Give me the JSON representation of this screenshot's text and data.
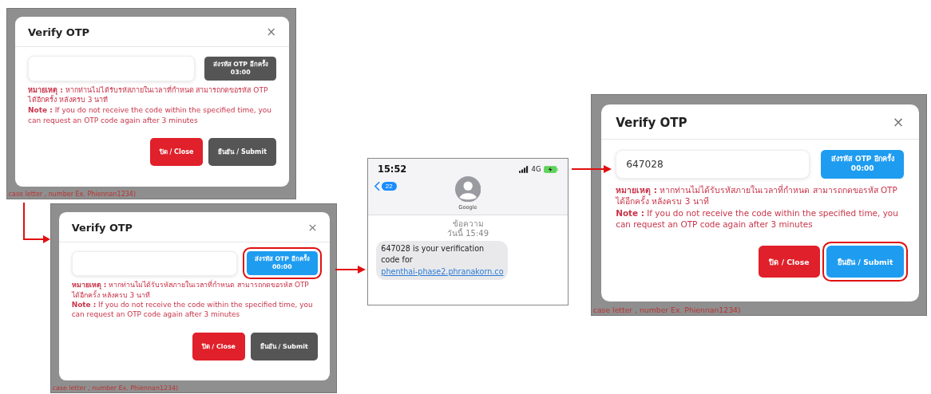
{
  "panels": [
    {
      "kind": "dialog",
      "title": "Verify OTP",
      "close_icon": "×",
      "resend": {
        "label": "ส่งรหัส OTP อีกครั้ง",
        "timer": "03:00",
        "enabled": false,
        "highlighted": false
      },
      "note_th": "**หมายเหตุ :** หากท่านไม่ได้รับรหัสภายในเวลาที่กำหนด สามารถกดขอรหัส OTP ได้อีกครั้ง หลังครบ 3 นาที",
      "note_en": "**Note :** If you do not receive the code within the specified time, you can request an OTP code again after 3 minutes",
      "close_button": "ปิด / Close",
      "submit": {
        "label": "ยืนยัน / Submit",
        "enabled": false,
        "highlighted": false
      },
      "background_text": "case letter , number Ex. Phiennan1234)"
    },
    {
      "kind": "dialog",
      "title": "Verify OTP",
      "close_icon": "×",
      "resend": {
        "label": "ส่งรหัส OTP อีกครั้ง",
        "timer": "00:00",
        "enabled": true,
        "highlighted": true
      },
      "note_th": "**หมายเหตุ :** หากท่านไม่ได้รับรหัสภายในเวลาที่กำหนด สามารถกดขอรหัส OTP ได้อีกครั้ง หลังครบ 3 นาที",
      "note_en": "**Note :** If you do not receive the code within the specified time, you can request an OTP code again after 3 minutes",
      "close_button": "ปิด / Close",
      "submit": {
        "label": "ยืนยัน / Submit",
        "enabled": false,
        "highlighted": false
      },
      "background_text": "case letter , number Ex. Phiennan1234)"
    },
    {
      "kind": "phone",
      "time": "15:52",
      "network": "4G",
      "back_badge": "22",
      "contact": "Google",
      "date_lines": [
        "ข้อความ",
        "วันนี้ 15:49"
      ],
      "message": "647028 is your verification code for ",
      "link": "phenthai-phase2.phranakorn.co"
    },
    {
      "kind": "dialog",
      "title": "Verify OTP",
      "close_icon": "×",
      "otp_value": "647028",
      "resend": {
        "label": "ส่งรหัส OTP อีกครั้ง",
        "timer": "00:00",
        "enabled": true,
        "highlighted": false
      },
      "note_th": "**หมายเหตุ :** หากท่านไม่ได้รับรหัสภายในเวลาที่กำหนด สามารถกดขอรหัส OTP ได้อีกครั้ง หลังครบ 3 นาที",
      "note_en": "**Note :** If you do not receive the code within the specified time, you can request an OTP code again after 3 minutes",
      "close_button": "ปิด / Close",
      "submit": {
        "label": "ยืนยัน / Submit",
        "enabled": true,
        "highlighted": true
      },
      "background_text": "case letter , number Ex. Phiennan1234)"
    }
  ]
}
